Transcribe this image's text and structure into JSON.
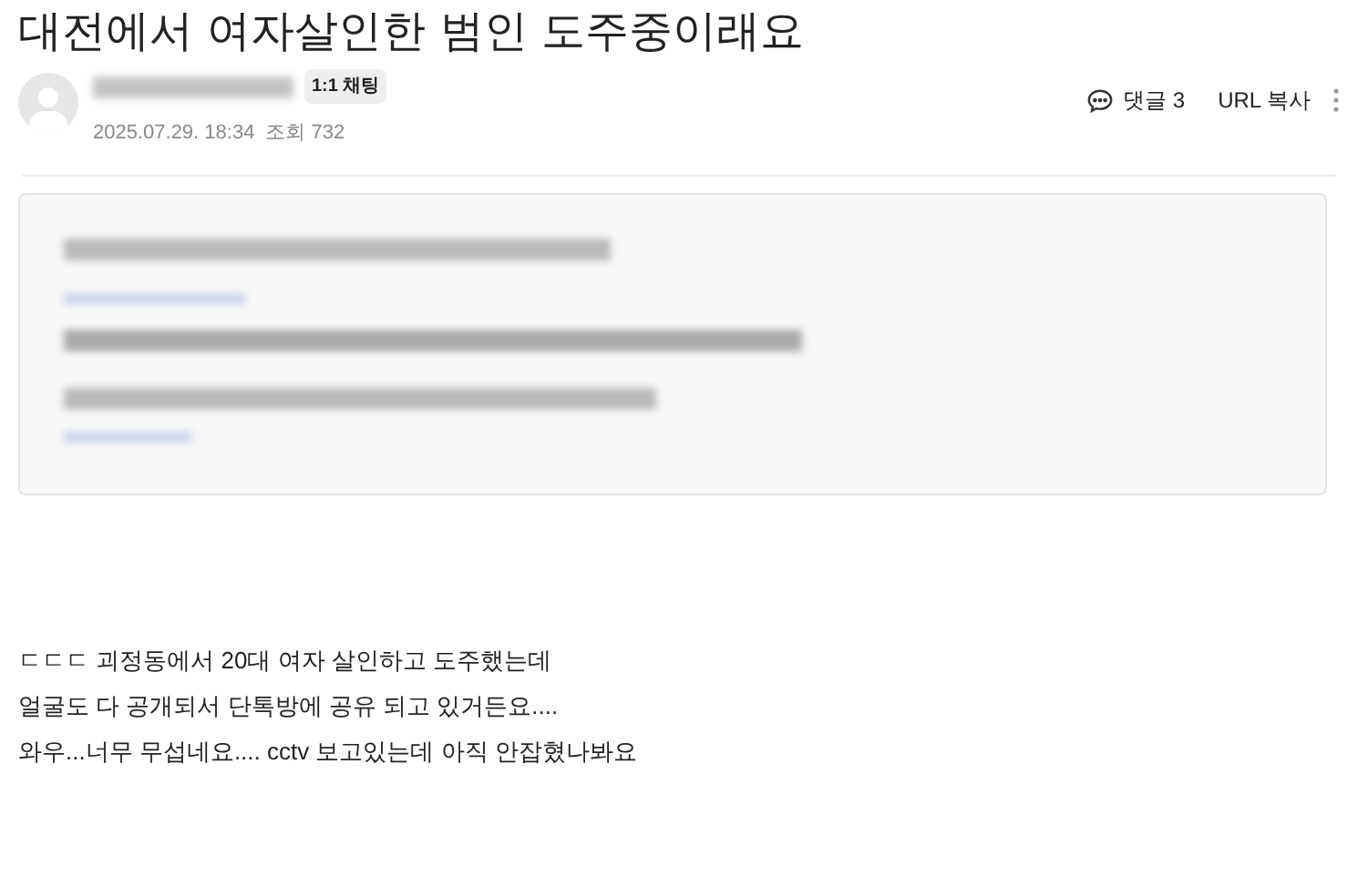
{
  "title": "대전에서 여자살인한 범인 도주중이래요",
  "author": {
    "chat_button": "1:1 채팅",
    "date": "2025.07.29. 18:34",
    "views": "조회 732"
  },
  "actions": {
    "comments": "댓글 3",
    "url_copy": "URL 복사"
  },
  "body": [
    "ㄷㄷㄷ 괴정동에서 20대 여자 살인하고 도주했는데",
    "얼굴도 다 공개되서 단톡방에 공유 되고 있거든요....",
    "와우...너무 무섭네요.... cctv 보고있는데 아직 안잡혔나봐요"
  ]
}
